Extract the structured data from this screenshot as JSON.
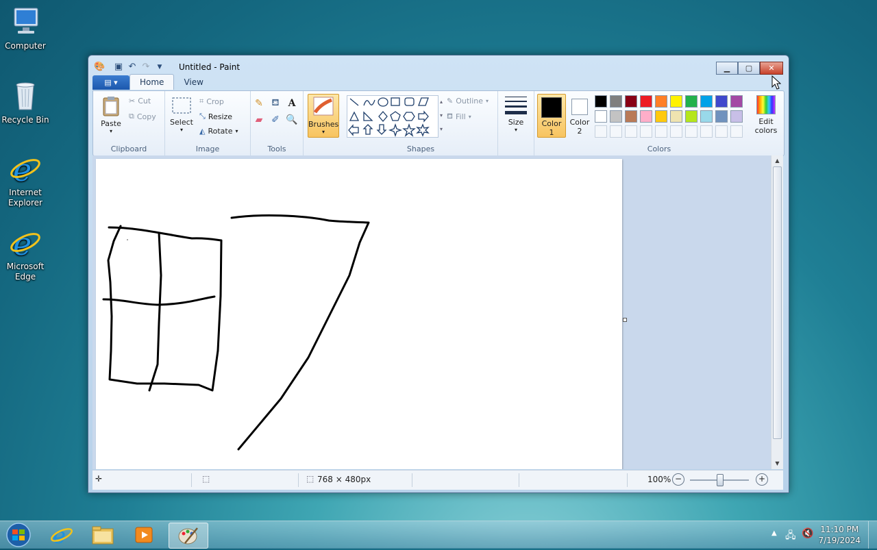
{
  "desktop": {
    "icons": [
      {
        "label": "Computer"
      },
      {
        "label": "Recycle Bin"
      },
      {
        "label": "Internet Explorer"
      },
      {
        "label": "Microsoft Edge"
      }
    ]
  },
  "window": {
    "title": "Untitled - Paint",
    "tabs": {
      "home": "Home",
      "view": "View"
    },
    "clipboard": {
      "paste": "Paste",
      "cut": "Cut",
      "copy": "Copy",
      "label": "Clipboard"
    },
    "image": {
      "select": "Select",
      "crop": "Crop",
      "resize": "Resize",
      "rotate": "Rotate",
      "label": "Image"
    },
    "tools": {
      "label": "Tools"
    },
    "brushes": {
      "label": "Brushes"
    },
    "shapes": {
      "outline": "Outline",
      "fill": "Fill",
      "label": "Shapes"
    },
    "size": {
      "label": "Size"
    },
    "colors": {
      "color1": "Color 1",
      "color2": "Color 2",
      "edit": "Edit colors",
      "label": "Colors",
      "row1": [
        "#000000",
        "#7f7f7f",
        "#880015",
        "#ed1c24",
        "#ff7f27",
        "#fff200",
        "#22b14c",
        "#00a2e8",
        "#3f48cc",
        "#a349a4"
      ],
      "row2": [
        "#ffffff",
        "#c3c3c3",
        "#b97a57",
        "#ffaec9",
        "#ffc90e",
        "#efe4b0",
        "#b5e61d",
        "#99d9ea",
        "#7092be",
        "#c8bfe7"
      ]
    },
    "status": {
      "dimensions": "768 × 480px",
      "zoom": "100%"
    }
  },
  "taskbar": {
    "time": "11:10 PM",
    "date": "7/19/2024"
  }
}
